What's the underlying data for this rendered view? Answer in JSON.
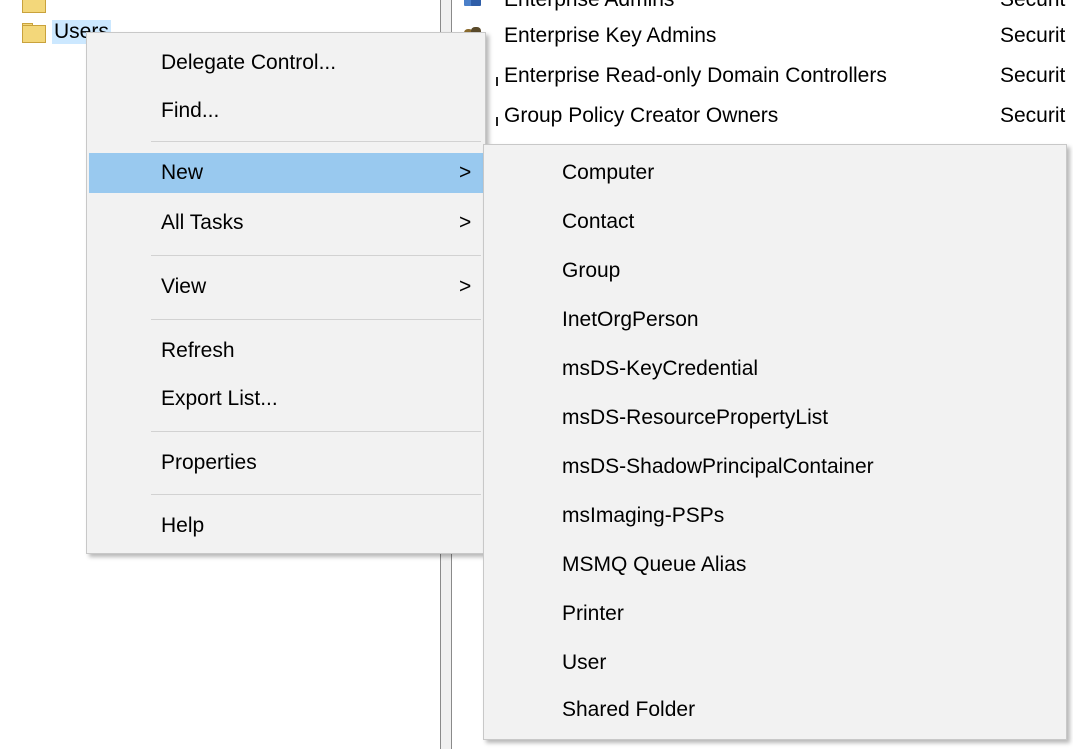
{
  "tree": {
    "items": [
      {
        "label": ""
      },
      {
        "label": "Users"
      }
    ]
  },
  "list": {
    "rows": [
      {
        "name": "Enterprise Admins",
        "type": "Securit",
        "icon": "group-icon"
      },
      {
        "name": "Enterprise Key Admins",
        "type": "Securit",
        "icon": "group-icon"
      },
      {
        "name": "Enterprise Read-only Domain Controllers",
        "type": "Securit",
        "icon": "group-icon"
      },
      {
        "name": "Group Policy Creator Owners",
        "type": "Securit",
        "icon": "group-icon"
      }
    ],
    "edge_fragment": "i"
  },
  "context_menu": {
    "items": [
      {
        "label": "Delegate Control...",
        "submenu": false
      },
      {
        "label": "Find...",
        "submenu": false
      },
      {
        "label": "New",
        "submenu": true,
        "highlighted": true
      },
      {
        "label": "All Tasks",
        "submenu": true
      },
      {
        "label": "View",
        "submenu": true
      },
      {
        "label": "Refresh",
        "submenu": false
      },
      {
        "label": "Export List...",
        "submenu": false
      },
      {
        "label": "Properties",
        "submenu": false
      },
      {
        "label": "Help",
        "submenu": false
      }
    ],
    "arrow_glyph": ">"
  },
  "new_submenu": {
    "items": [
      {
        "label": "Computer"
      },
      {
        "label": "Contact"
      },
      {
        "label": "Group"
      },
      {
        "label": "InetOrgPerson"
      },
      {
        "label": "msDS-KeyCredential"
      },
      {
        "label": "msDS-ResourcePropertyList"
      },
      {
        "label": "msDS-ShadowPrincipalContainer"
      },
      {
        "label": "msImaging-PSPs"
      },
      {
        "label": "MSMQ Queue Alias"
      },
      {
        "label": "Printer"
      },
      {
        "label": "User"
      },
      {
        "label": "Shared Folder"
      }
    ]
  },
  "colors": {
    "highlight": "#99c9ef",
    "menu_bg": "#f2f2f2",
    "selection": "#cce8ff"
  }
}
